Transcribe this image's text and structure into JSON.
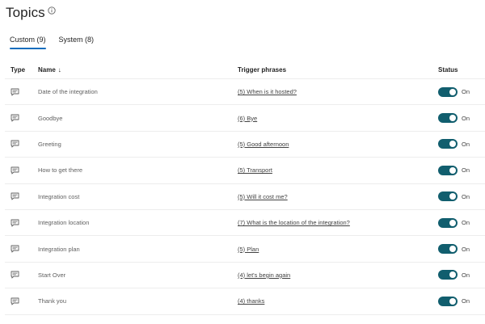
{
  "page": {
    "title": "Topics"
  },
  "tabs": [
    {
      "label": "Custom (9)",
      "active": true
    },
    {
      "label": "System (8)",
      "active": false
    }
  ],
  "table": {
    "headers": {
      "type": "Type",
      "name": "Name",
      "sort_glyph": "↓",
      "trigger": "Trigger phrases",
      "status": "Status"
    },
    "rows": [
      {
        "icon": "chat-icon",
        "name": "Date of the integration",
        "trigger": "(5) When is it hosted?",
        "status": "On"
      },
      {
        "icon": "chat-icon",
        "name": "Goodbye",
        "trigger": "(6) Bye",
        "status": "On"
      },
      {
        "icon": "chat-icon",
        "name": "Greeting",
        "trigger": "(5) Good afternoon",
        "status": "On"
      },
      {
        "icon": "chat-icon",
        "name": "How to get there",
        "trigger": "(5) Transport",
        "status": "On"
      },
      {
        "icon": "chat-icon",
        "name": "Integration cost",
        "trigger": "(5) Will it cost me?",
        "status": "On"
      },
      {
        "icon": "chat-icon",
        "name": "Integration location",
        "trigger": "(7) What is the location of the integration?",
        "status": "On"
      },
      {
        "icon": "chat-icon",
        "name": "Integration plan",
        "trigger": "(5) Plan",
        "status": "On"
      },
      {
        "icon": "chat-icon",
        "name": "Start Over",
        "trigger": "(4) let's begin again",
        "status": "On"
      },
      {
        "icon": "chat-icon",
        "name": "Thank you",
        "trigger": "(4) thanks",
        "status": "On"
      }
    ]
  },
  "colors": {
    "toggle_on": "#115e6e",
    "tab_indicator": "#0f6cbd"
  }
}
